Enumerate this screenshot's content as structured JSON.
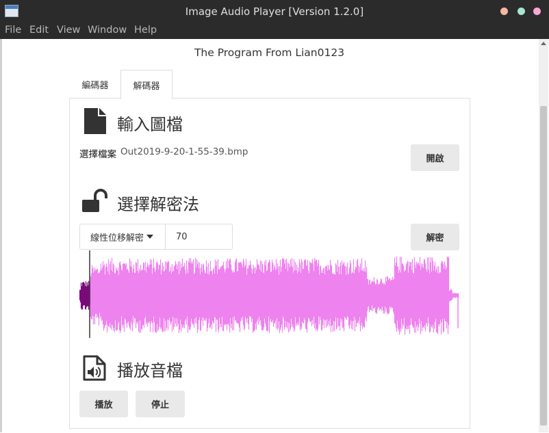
{
  "window": {
    "title": "Image Audio Player [Version 1.2.0]",
    "controls": [
      {
        "name": "close",
        "color": "#f7b7a3"
      },
      {
        "name": "maximize",
        "color": "#a8e6cf"
      },
      {
        "name": "minimize",
        "color": "#f9a8d4"
      }
    ]
  },
  "menu": {
    "file": "File",
    "edit": "Edit",
    "view": "View",
    "window": "Window",
    "help": "Help"
  },
  "header": "The Program From Lian0123",
  "tabs": {
    "encoder": "編碼器",
    "decoder": "解碼器"
  },
  "input_section": {
    "title": "輸入圖檔",
    "icon": "file-icon",
    "choose_label": "選擇檔案",
    "file_name": "Out2019-9-20-1-55-39.bmp",
    "open_button": "開啟"
  },
  "decrypt_section": {
    "title": "選擇解密法",
    "icon": "unlock-icon",
    "method": "線性位移解密",
    "shift_value": "70",
    "decrypt_button": "解密"
  },
  "waveform": {
    "played_color": "#7a0a7a",
    "unplayed_color": "#ee82ee",
    "cursor_color": "#000000",
    "played_fraction": 0.025
  },
  "play_section": {
    "title": "播放音檔",
    "icon": "audio-file-icon",
    "play_button": "播放",
    "stop_button": "停止"
  },
  "colors": {
    "titlebar": "#2b2b2b",
    "button_bg": "#e9e9e9"
  }
}
